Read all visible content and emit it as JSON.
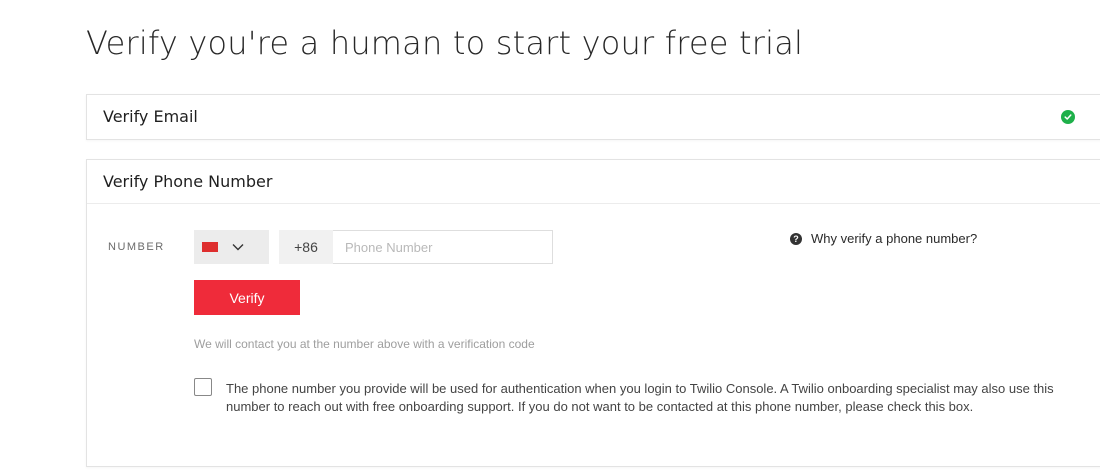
{
  "page": {
    "title": "Verify you're a human to start your free trial"
  },
  "email_section": {
    "title": "Verify Email",
    "status_icon": "check-circle-icon",
    "status_color": "#1eb04a"
  },
  "phone_section": {
    "title": "Verify Phone Number",
    "number_label": "NUMBER",
    "country": {
      "flag_icon": "china-flag-icon",
      "flag_color": "#de2e2e",
      "dial_code": "+86"
    },
    "phone_input": {
      "placeholder": "Phone Number",
      "value": ""
    },
    "why_link": "Why verify a phone number?",
    "verify_button": "Verify",
    "help_text": "We will contact you at the number above with a verification code",
    "consent_text": "The phone number you provide will be used for authentication when you login to Twilio Console. A Twilio onboarding specialist may also use this number to reach out with free onboarding support. If you do not want to be contacted at this phone number, please check this box.",
    "consent_checked": false
  },
  "colors": {
    "accent": "#ef2b3a"
  }
}
